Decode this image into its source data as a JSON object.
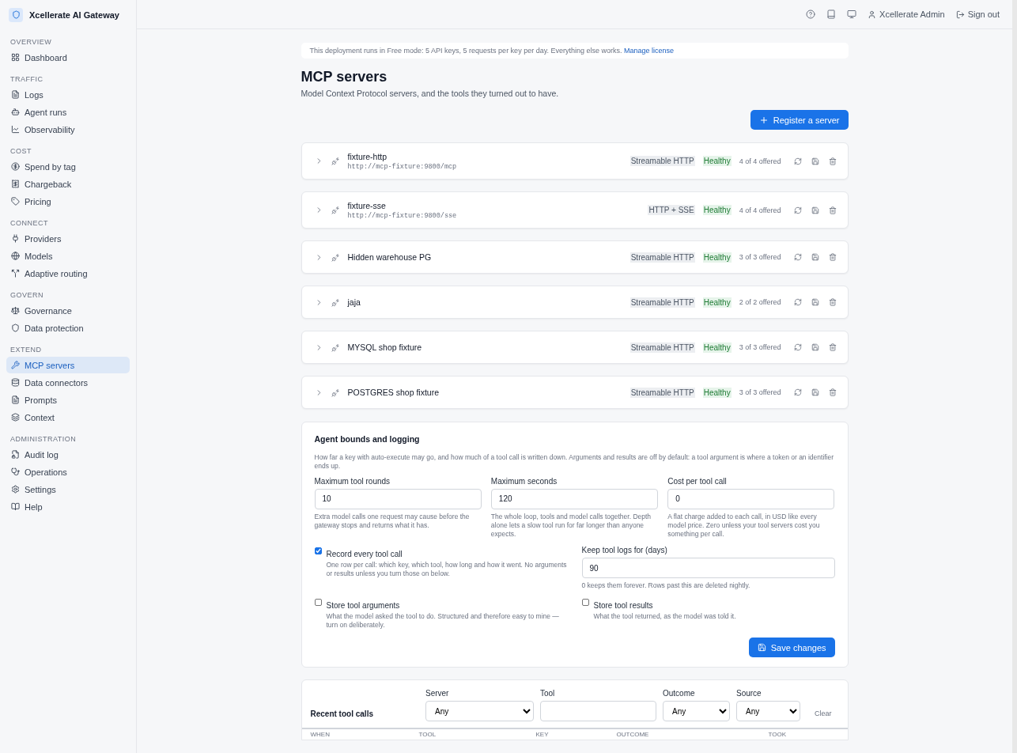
{
  "app": {
    "name": "Xcellerate AI Gateway"
  },
  "sidebar": {
    "sections": [
      {
        "title": "OVERVIEW",
        "items": [
          {
            "label": "Dashboard",
            "selected": false
          }
        ]
      },
      {
        "title": "TRAFFIC",
        "items": [
          {
            "label": "Logs",
            "selected": false
          },
          {
            "label": "Agent runs",
            "selected": false
          },
          {
            "label": "Observability",
            "selected": false
          }
        ]
      },
      {
        "title": "COST",
        "items": [
          {
            "label": "Spend by tag",
            "selected": false
          },
          {
            "label": "Chargeback",
            "selected": false
          },
          {
            "label": "Pricing",
            "selected": false
          }
        ]
      },
      {
        "title": "CONNECT",
        "items": [
          {
            "label": "Providers",
            "selected": false
          },
          {
            "label": "Models",
            "selected": false
          },
          {
            "label": "Adaptive routing",
            "selected": false
          }
        ]
      },
      {
        "title": "GOVERN",
        "items": [
          {
            "label": "Governance",
            "selected": false
          },
          {
            "label": "Data protection",
            "selected": false
          }
        ]
      },
      {
        "title": "EXTEND",
        "items": [
          {
            "label": "MCP servers",
            "selected": true
          },
          {
            "label": "Data connectors",
            "selected": false
          },
          {
            "label": "Prompts",
            "selected": false
          },
          {
            "label": "Context",
            "selected": false
          }
        ]
      },
      {
        "title": "ADMINISTRATION",
        "items": [
          {
            "label": "Audit log",
            "selected": false
          },
          {
            "label": "Operations",
            "selected": false
          },
          {
            "label": "Settings",
            "selected": false
          },
          {
            "label": "Help",
            "selected": false
          }
        ]
      }
    ]
  },
  "topbar": {
    "user": "Xcellerate Admin",
    "sign_out": "Sign out"
  },
  "notice": {
    "text": "This deployment runs in Free mode: 5 API keys, 5 requests per key per day. Everything else works.",
    "link": "Manage license"
  },
  "page": {
    "title": "MCP servers",
    "subtitle": "Model Context Protocol servers, and the tools they turned out to have.",
    "primary_button": "Register a server"
  },
  "servers": [
    {
      "name": "fixture-http",
      "url": "http://mcp-fixture:9800/mcp",
      "transport": "Streamable HTTP",
      "health": "Healthy",
      "offered": "4 of 4 offered"
    },
    {
      "name": "fixture-sse",
      "url": "http://mcp-fixture:9800/sse",
      "transport": "HTTP + SSE",
      "health": "Healthy",
      "offered": "4 of 4 offered"
    },
    {
      "name": "Hidden warehouse PG",
      "transport": "Streamable HTTP",
      "health": "Healthy",
      "offered": "3 of 3 offered"
    },
    {
      "name": "jaja",
      "transport": "Streamable HTTP",
      "health": "Healthy",
      "offered": "2 of 2 offered"
    },
    {
      "name": "MYSQL shop fixture",
      "transport": "Streamable HTTP",
      "health": "Healthy",
      "offered": "3 of 3 offered"
    },
    {
      "name": "POSTGRES shop fixture",
      "transport": "Streamable HTTP",
      "health": "Healthy",
      "offered": "3 of 3 offered"
    }
  ],
  "settings": {
    "title": "Agent bounds and logging",
    "description": "How far a key with auto-execute may go, and how much of a tool call is written down. Arguments and results are off by default: a tool argument is where a token or an identifier ends up.",
    "fields": [
      {
        "label": "Maximum tool rounds",
        "value": "10",
        "help": "Extra model calls one request may cause before the gateway stops and returns what it has."
      },
      {
        "label": "Maximum seconds",
        "value": "120",
        "help": "The whole loop, tools and model calls together. Depth alone lets a slow tool run for far longer than anyone expects."
      },
      {
        "label": "Cost per tool call",
        "value": "0",
        "help": "A flat charge added to each call, in USD like every model price. Zero unless your tool servers cost you something per call."
      }
    ],
    "record": {
      "label": "Record every tool call",
      "checked": true,
      "help": "One row per call: which key, which tool, how long and how it went. No arguments or results unless you turn those on below."
    },
    "retention": {
      "label": "Keep tool logs for (days)",
      "value": "90",
      "help": "0 keeps them forever. Rows past this are deleted nightly."
    },
    "store_arguments": {
      "label": "Store tool arguments",
      "checked": false,
      "help": "What the model asked the tool to do. Structured and therefore easy to mine — turn on deliberately."
    },
    "store_results": {
      "label": "Store tool results",
      "checked": false,
      "help": "What the tool returned, as the model was told it."
    },
    "save_button": "Save changes"
  },
  "recent": {
    "title": "Recent tool calls",
    "filters": [
      {
        "kind": "select",
        "label": "Server",
        "value": "Any"
      },
      {
        "kind": "text",
        "label": "Tool"
      },
      {
        "kind": "select",
        "label": "Outcome",
        "value": "Any"
      },
      {
        "kind": "select",
        "label": "Source",
        "value": "Any"
      }
    ],
    "clear": "Clear",
    "columns": [
      "WHEN",
      "TOOL",
      "KEY",
      "OUTCOME",
      "TOOK"
    ]
  }
}
